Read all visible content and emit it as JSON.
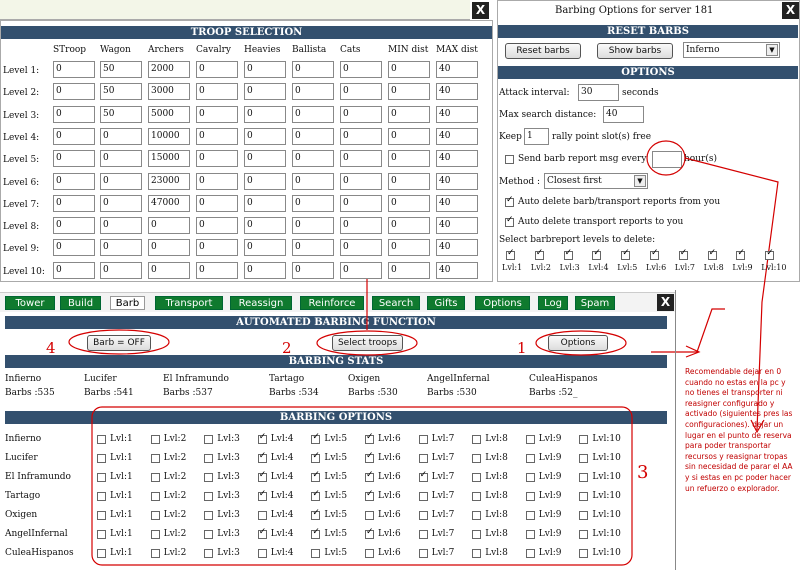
{
  "troop": {
    "title": "TROOP SELECTION",
    "headers": [
      "STroop",
      "Wagon",
      "Archers",
      "Cavalry",
      "Heavies",
      "Ballista",
      "Cats",
      "MIN dist",
      "MAX dist"
    ],
    "rows": [
      {
        "label": "Level 1:",
        "values": [
          "0",
          "50",
          "2000",
          "0",
          "0",
          "0",
          "0",
          "0",
          "40"
        ]
      },
      {
        "label": "Level 2:",
        "values": [
          "0",
          "50",
          "3000",
          "0",
          "0",
          "0",
          "0",
          "0",
          "40"
        ]
      },
      {
        "label": "Level 3:",
        "values": [
          "0",
          "50",
          "5000",
          "0",
          "0",
          "0",
          "0",
          "0",
          "40"
        ]
      },
      {
        "label": "Level 4:",
        "values": [
          "0",
          "0",
          "10000",
          "0",
          "0",
          "0",
          "0",
          "0",
          "40"
        ]
      },
      {
        "label": "Level 5:",
        "values": [
          "0",
          "0",
          "15000",
          "0",
          "0",
          "0",
          "0",
          "0",
          "40"
        ]
      },
      {
        "label": "Level 6:",
        "values": [
          "0",
          "0",
          "23000",
          "0",
          "0",
          "0",
          "0",
          "0",
          "40"
        ]
      },
      {
        "label": "Level 7:",
        "values": [
          "0",
          "0",
          "47000",
          "0",
          "0",
          "0",
          "0",
          "0",
          "40"
        ]
      },
      {
        "label": "Level 8:",
        "values": [
          "0",
          "0",
          "0",
          "0",
          "0",
          "0",
          "0",
          "0",
          "40"
        ]
      },
      {
        "label": "Level 9:",
        "values": [
          "0",
          "0",
          "0",
          "0",
          "0",
          "0",
          "0",
          "0",
          "40"
        ]
      },
      {
        "label": "Level 10:",
        "values": [
          "0",
          "0",
          "0",
          "0",
          "0",
          "0",
          "0",
          "0",
          "40"
        ]
      }
    ]
  },
  "options_panel": {
    "title": "Barbing Options for server 181",
    "reset_title": "RESET BARBS",
    "reset_button": "Reset barbs",
    "show_button": "Show barbs",
    "server_select": "Inferno",
    "options_title": "OPTIONS",
    "attack_label": "Attack interval:",
    "attack_value": "30",
    "attack_unit": "seconds",
    "max_search_label": "Max search distance:",
    "max_search_value": "40",
    "keep_label_pre": "Keep",
    "keep_value": "1",
    "keep_label_post": "rally point slot(s) free",
    "send_report_label_pre": "Send barb report msg every",
    "send_report_label_post": "hour(s)",
    "method_label": "Method :",
    "method_value": "Closest first",
    "auto_barb_label": "Auto delete barb/transport reports from you",
    "auto_transport_label": "Auto delete transport reports to you",
    "select_levels_label": "Select barbreport levels to delete:",
    "level_labels": [
      "Lvl:1",
      "Lvl:2",
      "Lvl:3",
      "Lvl:4",
      "Lvl:5",
      "Lvl:6",
      "Lvl:7",
      "Lvl:8",
      "Lvl:9",
      "Lvl:10"
    ]
  },
  "tabs": [
    "Tower",
    "Build",
    "Barb",
    "Transport",
    "Reassign",
    "Reinforce",
    "Search",
    "Gifts",
    "Options",
    "Log",
    "Spam"
  ],
  "auto": {
    "title": "AUTOMATED BARBING FUNCTION",
    "barb_off": "Barb = OFF",
    "select_troops": "Select troops",
    "options": "Options"
  },
  "stats": {
    "title": "BARBING STATS",
    "cities": [
      {
        "name": "Infierno",
        "count": "Barbs :535"
      },
      {
        "name": "Lucifer",
        "count": "Barbs :541"
      },
      {
        "name": "El Inframundo",
        "count": "Barbs :537"
      },
      {
        "name": "Tartago",
        "count": "Barbs :534"
      },
      {
        "name": "Oxigen",
        "count": "Barbs :530"
      },
      {
        "name": "AngelInfernal",
        "count": "Barbs :530"
      },
      {
        "name": "CuleaHispanos",
        "count": "Barbs :52_"
      }
    ]
  },
  "barbing_options": {
    "title": "BARBING OPTIONS",
    "cities": [
      "Infierno",
      "Lucifer",
      "El Inframundo",
      "Tartago",
      "Oxigen",
      "AngelInfernal",
      "CuleaHispanos"
    ],
    "levels": [
      "Lvl:1",
      "Lvl:2",
      "Lvl:3",
      "Lvl:4",
      "Lvl:5",
      "Lvl:6",
      "Lvl:7",
      "Lvl:8",
      "Lvl:9",
      "Lvl:10"
    ]
  },
  "annotations": {
    "n1": "1",
    "n2": "2",
    "n3": "3",
    "n4": "4",
    "note": "Recomendable dejar en 0 cuando no estas en la pc y no tienes el transporter ni reasigner configurado y activado (siguientes pres las configuraciones). dejar un lugar en el punto de reserva para poder transportar recursos y reasignar tropas sin necesidad de parar el AA y si estas en pc poder hacer un refuerzo o explorador.",
    "color": "#cc0000"
  },
  "colors": {
    "header_bar": "#33506e",
    "tab_green": "#0f7a2e"
  }
}
